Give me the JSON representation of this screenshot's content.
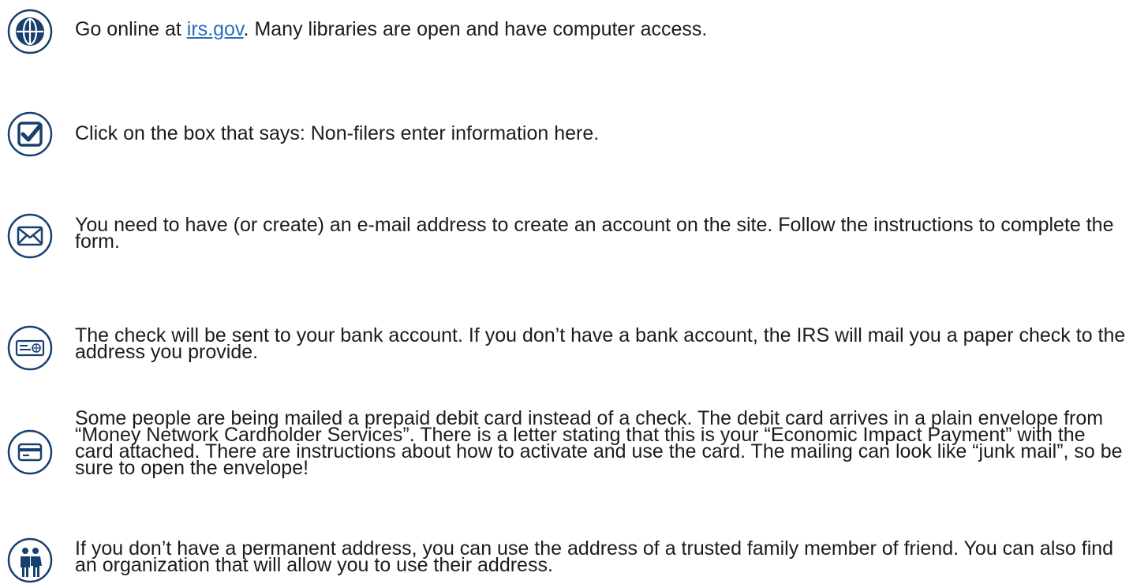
{
  "steps": [
    {
      "icon": "globe-icon",
      "text_before": "Go online at ",
      "link_text": "irs.gov",
      "text_after": ". Many libraries are open and have computer access."
    },
    {
      "icon": "checkbox-icon",
      "text": "Click on the box that says: Non-filers enter information here."
    },
    {
      "icon": "envelope-icon",
      "text": "You need to have (or create) an e-mail address to create an account on the site. Follow the instructions to complete the form."
    },
    {
      "icon": "check-payment-icon",
      "text": "The check will be sent to your bank account. If you don’t have a bank account, the IRS will mail you a paper check to the address you provide."
    },
    {
      "icon": "debit-card-icon",
      "text": "Some people are being mailed a prepaid debit card instead of a check. The debit card arrives in a plain envelope from “Money Network Cardholder Services”. There is a letter stating that this is your “Economic Impact Payment” with the card attached. There are instructions about how to activate and use the card. The mailing can look like “junk mail”, so be sure to open the envelope!"
    },
    {
      "icon": "family-icon",
      "text": "If you don’t have a permanent address, you can use the address of a trusted family member of friend. You can also find an organization that will allow you to use their address."
    }
  ],
  "colors": {
    "icon_stroke": "#17406d",
    "link": "#2a6ebb",
    "text": "#1c1c1c"
  }
}
